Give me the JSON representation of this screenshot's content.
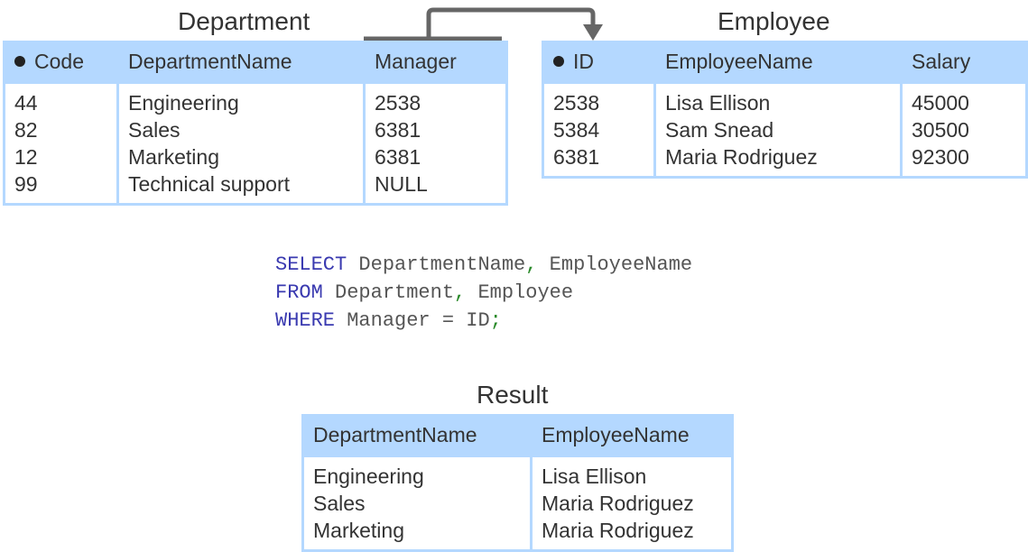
{
  "department": {
    "title": "Department",
    "columns": [
      "Code",
      "DepartmentName",
      "Manager"
    ],
    "primary_key": "Code",
    "rows": [
      [
        "44",
        "Engineering",
        "2538"
      ],
      [
        "82",
        "Sales",
        "6381"
      ],
      [
        "12",
        "Marketing",
        "6381"
      ],
      [
        "99",
        "Technical support",
        "NULL"
      ]
    ]
  },
  "employee": {
    "title": "Employee",
    "columns": [
      "ID",
      "EmployeeName",
      "Salary"
    ],
    "primary_key": "ID",
    "rows": [
      [
        "2538",
        "Lisa Ellison",
        "45000"
      ],
      [
        "5384",
        "Sam Snead",
        "30500"
      ],
      [
        "6381",
        "Maria Rodriguez",
        "92300"
      ]
    ]
  },
  "query": {
    "line1": {
      "kw": "SELECT",
      "a": "DepartmentName",
      "sep": ",",
      "b": "EmployeeName"
    },
    "line2": {
      "kw": "FROM",
      "a": "Department",
      "sep": ",",
      "b": "Employee"
    },
    "line3": {
      "kw": "WHERE",
      "a": "Manager",
      "op": "=",
      "b": "ID",
      "end": ";"
    }
  },
  "result": {
    "title": "Result",
    "columns": [
      "DepartmentName",
      "EmployeeName"
    ],
    "rows": [
      [
        "Engineering",
        "Lisa Ellison"
      ],
      [
        "Sales",
        "Maria Rodriguez"
      ],
      [
        "Marketing",
        "Maria Rodriguez"
      ]
    ]
  },
  "colors": {
    "header_fill": "#b4d8ff",
    "border": "#b4d8ff",
    "arrow": "#666666",
    "sql_keyword": "#3a3ab0",
    "sql_punctuation": "#2a8a2a"
  }
}
